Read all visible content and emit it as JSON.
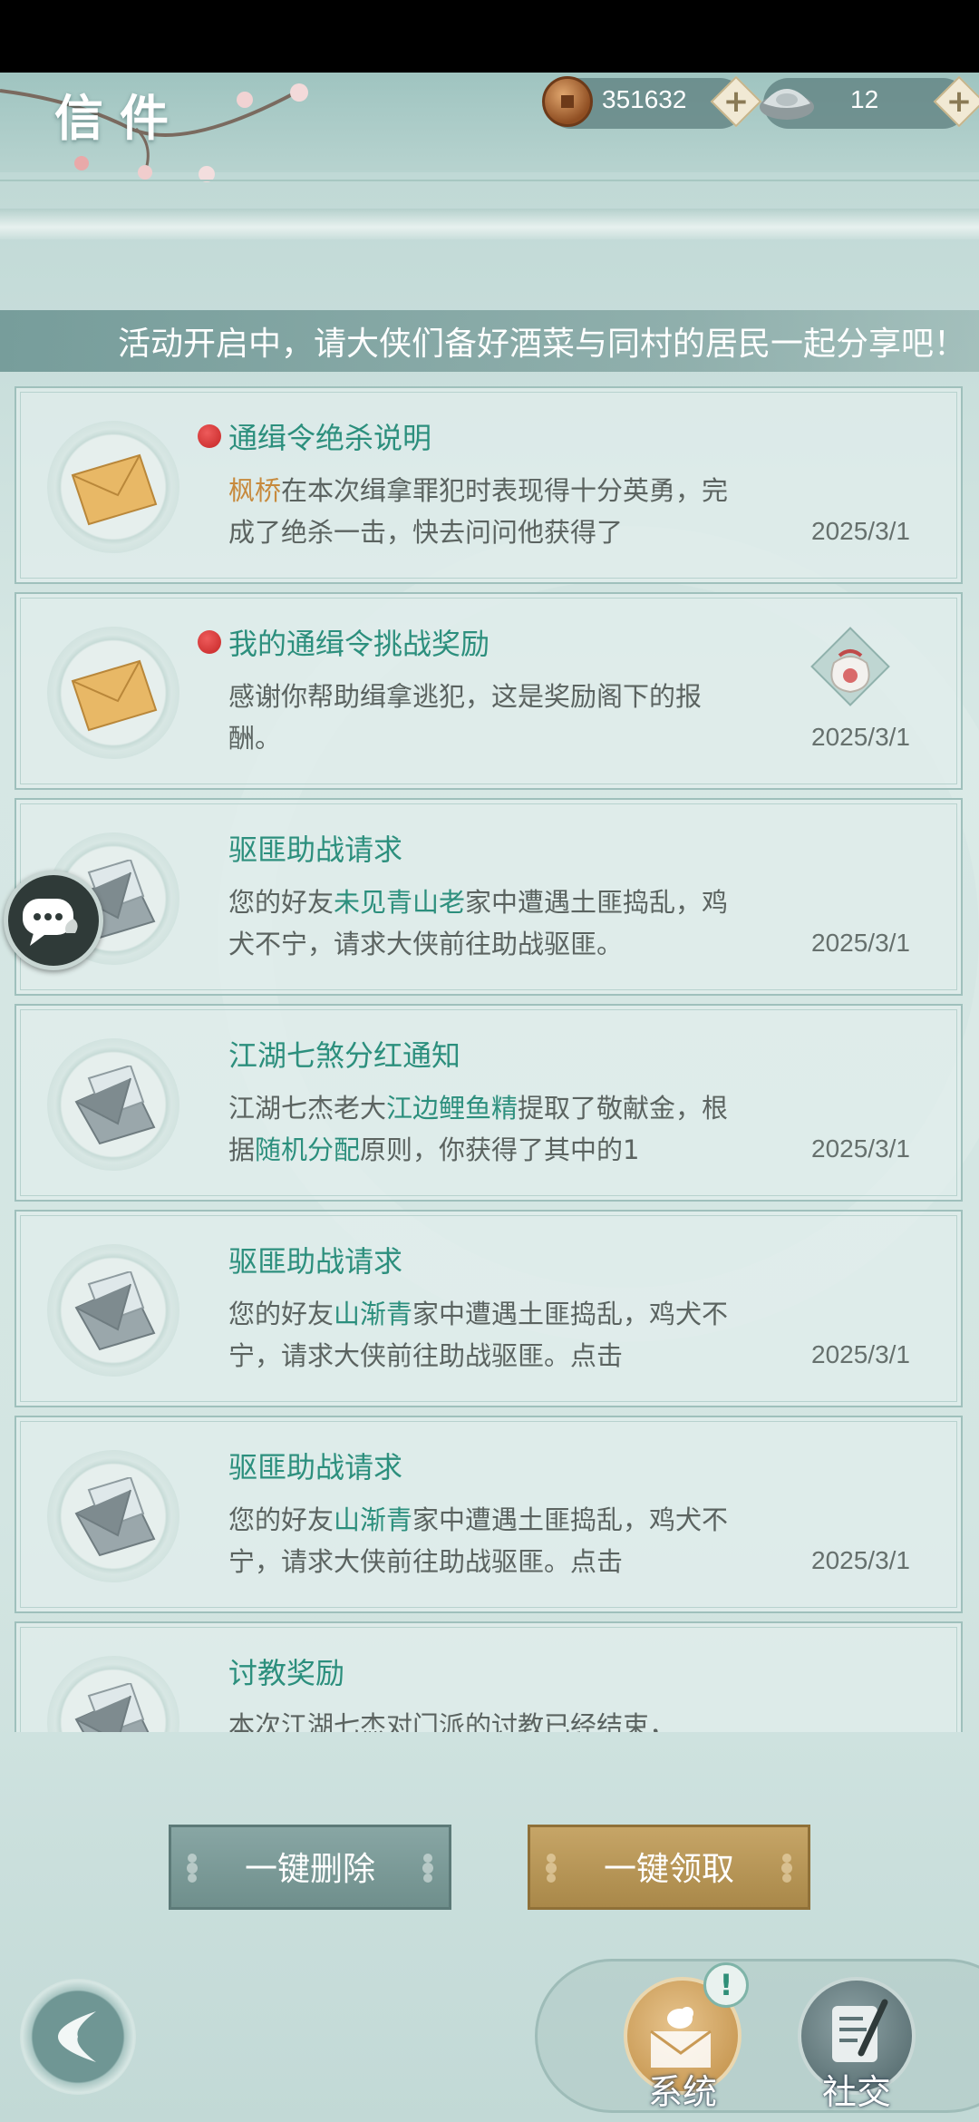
{
  "header": {
    "title": "信件",
    "copper": "351632",
    "silver": "12",
    "plus_label": "+"
  },
  "marquee": "活动开启中，请大侠们备好酒菜与同村的居民一起分享吧！",
  "mails": [
    {
      "title": "通缉令绝杀说明",
      "unread": true,
      "icon": "gold-envelope-icon",
      "body_parts": [
        {
          "text": "枫桥",
          "hl": "orange"
        },
        {
          "text": "在本次缉拿罪犯时表现得十分英勇，完成了绝杀一击，快去问问他获得了",
          "hl": ""
        }
      ],
      "date": "2025/3/1",
      "reward": false
    },
    {
      "title": "我的通缉令挑战奖励",
      "unread": true,
      "icon": "gold-envelope-icon",
      "body_parts": [
        {
          "text": "感谢你帮助缉拿逃犯，这是奖励阁下的报酬。",
          "hl": ""
        }
      ],
      "date": "2025/3/1",
      "reward": true
    },
    {
      "title": "驱匪助战请求",
      "unread": false,
      "icon": "open-envelope-icon",
      "body_parts": [
        {
          "text": "您的好友",
          "hl": ""
        },
        {
          "text": "未见青山老",
          "hl": "green"
        },
        {
          "text": "家中遭遇土匪捣乱，鸡犬不宁，请求大侠前往助战驱匪。",
          "hl": ""
        }
      ],
      "date": "2025/3/1",
      "reward": false
    },
    {
      "title": "江湖七煞分红通知",
      "unread": false,
      "icon": "open-envelope-icon",
      "body_parts": [
        {
          "text": "江湖七杰老大",
          "hl": ""
        },
        {
          "text": "江边鲤鱼精",
          "hl": "green"
        },
        {
          "text": "提取了敬献金，根据",
          "hl": ""
        },
        {
          "text": "随机分配",
          "hl": "green"
        },
        {
          "text": "原则，你获得了其中的1",
          "hl": ""
        }
      ],
      "date": "2025/3/1",
      "reward": false
    },
    {
      "title": "驱匪助战请求",
      "unread": false,
      "icon": "open-envelope-icon",
      "body_parts": [
        {
          "text": "您的好友",
          "hl": ""
        },
        {
          "text": "山渐青",
          "hl": "green"
        },
        {
          "text": "家中遭遇土匪捣乱，鸡犬不宁，请求大侠前往助战驱匪。点击",
          "hl": ""
        }
      ],
      "date": "2025/3/1",
      "reward": false
    },
    {
      "title": "驱匪助战请求",
      "unread": false,
      "icon": "open-envelope-icon",
      "body_parts": [
        {
          "text": "您的好友",
          "hl": ""
        },
        {
          "text": "山渐青",
          "hl": "green"
        },
        {
          "text": "家中遭遇土匪捣乱，鸡犬不宁，请求大侠前往助战驱匪。点击",
          "hl": ""
        }
      ],
      "date": "2025/3/1",
      "reward": false
    },
    {
      "title": "讨教奖励",
      "unread": false,
      "icon": "open-envelope-icon",
      "body_parts": [
        {
          "text": "本次江湖七杰对门派的讨教已经结束，",
          "hl": ""
        }
      ],
      "date": "",
      "reward": false
    }
  ],
  "buttons": {
    "delete_all": "一键删除",
    "claim_all": "一键领取"
  },
  "tabs": {
    "system": "系统",
    "social": "社交",
    "badge": "!"
  },
  "colors": {
    "accent_green": "#2c8f7d",
    "highlight_orange": "#c78a3d",
    "unread_dot": "#d33a3a"
  }
}
